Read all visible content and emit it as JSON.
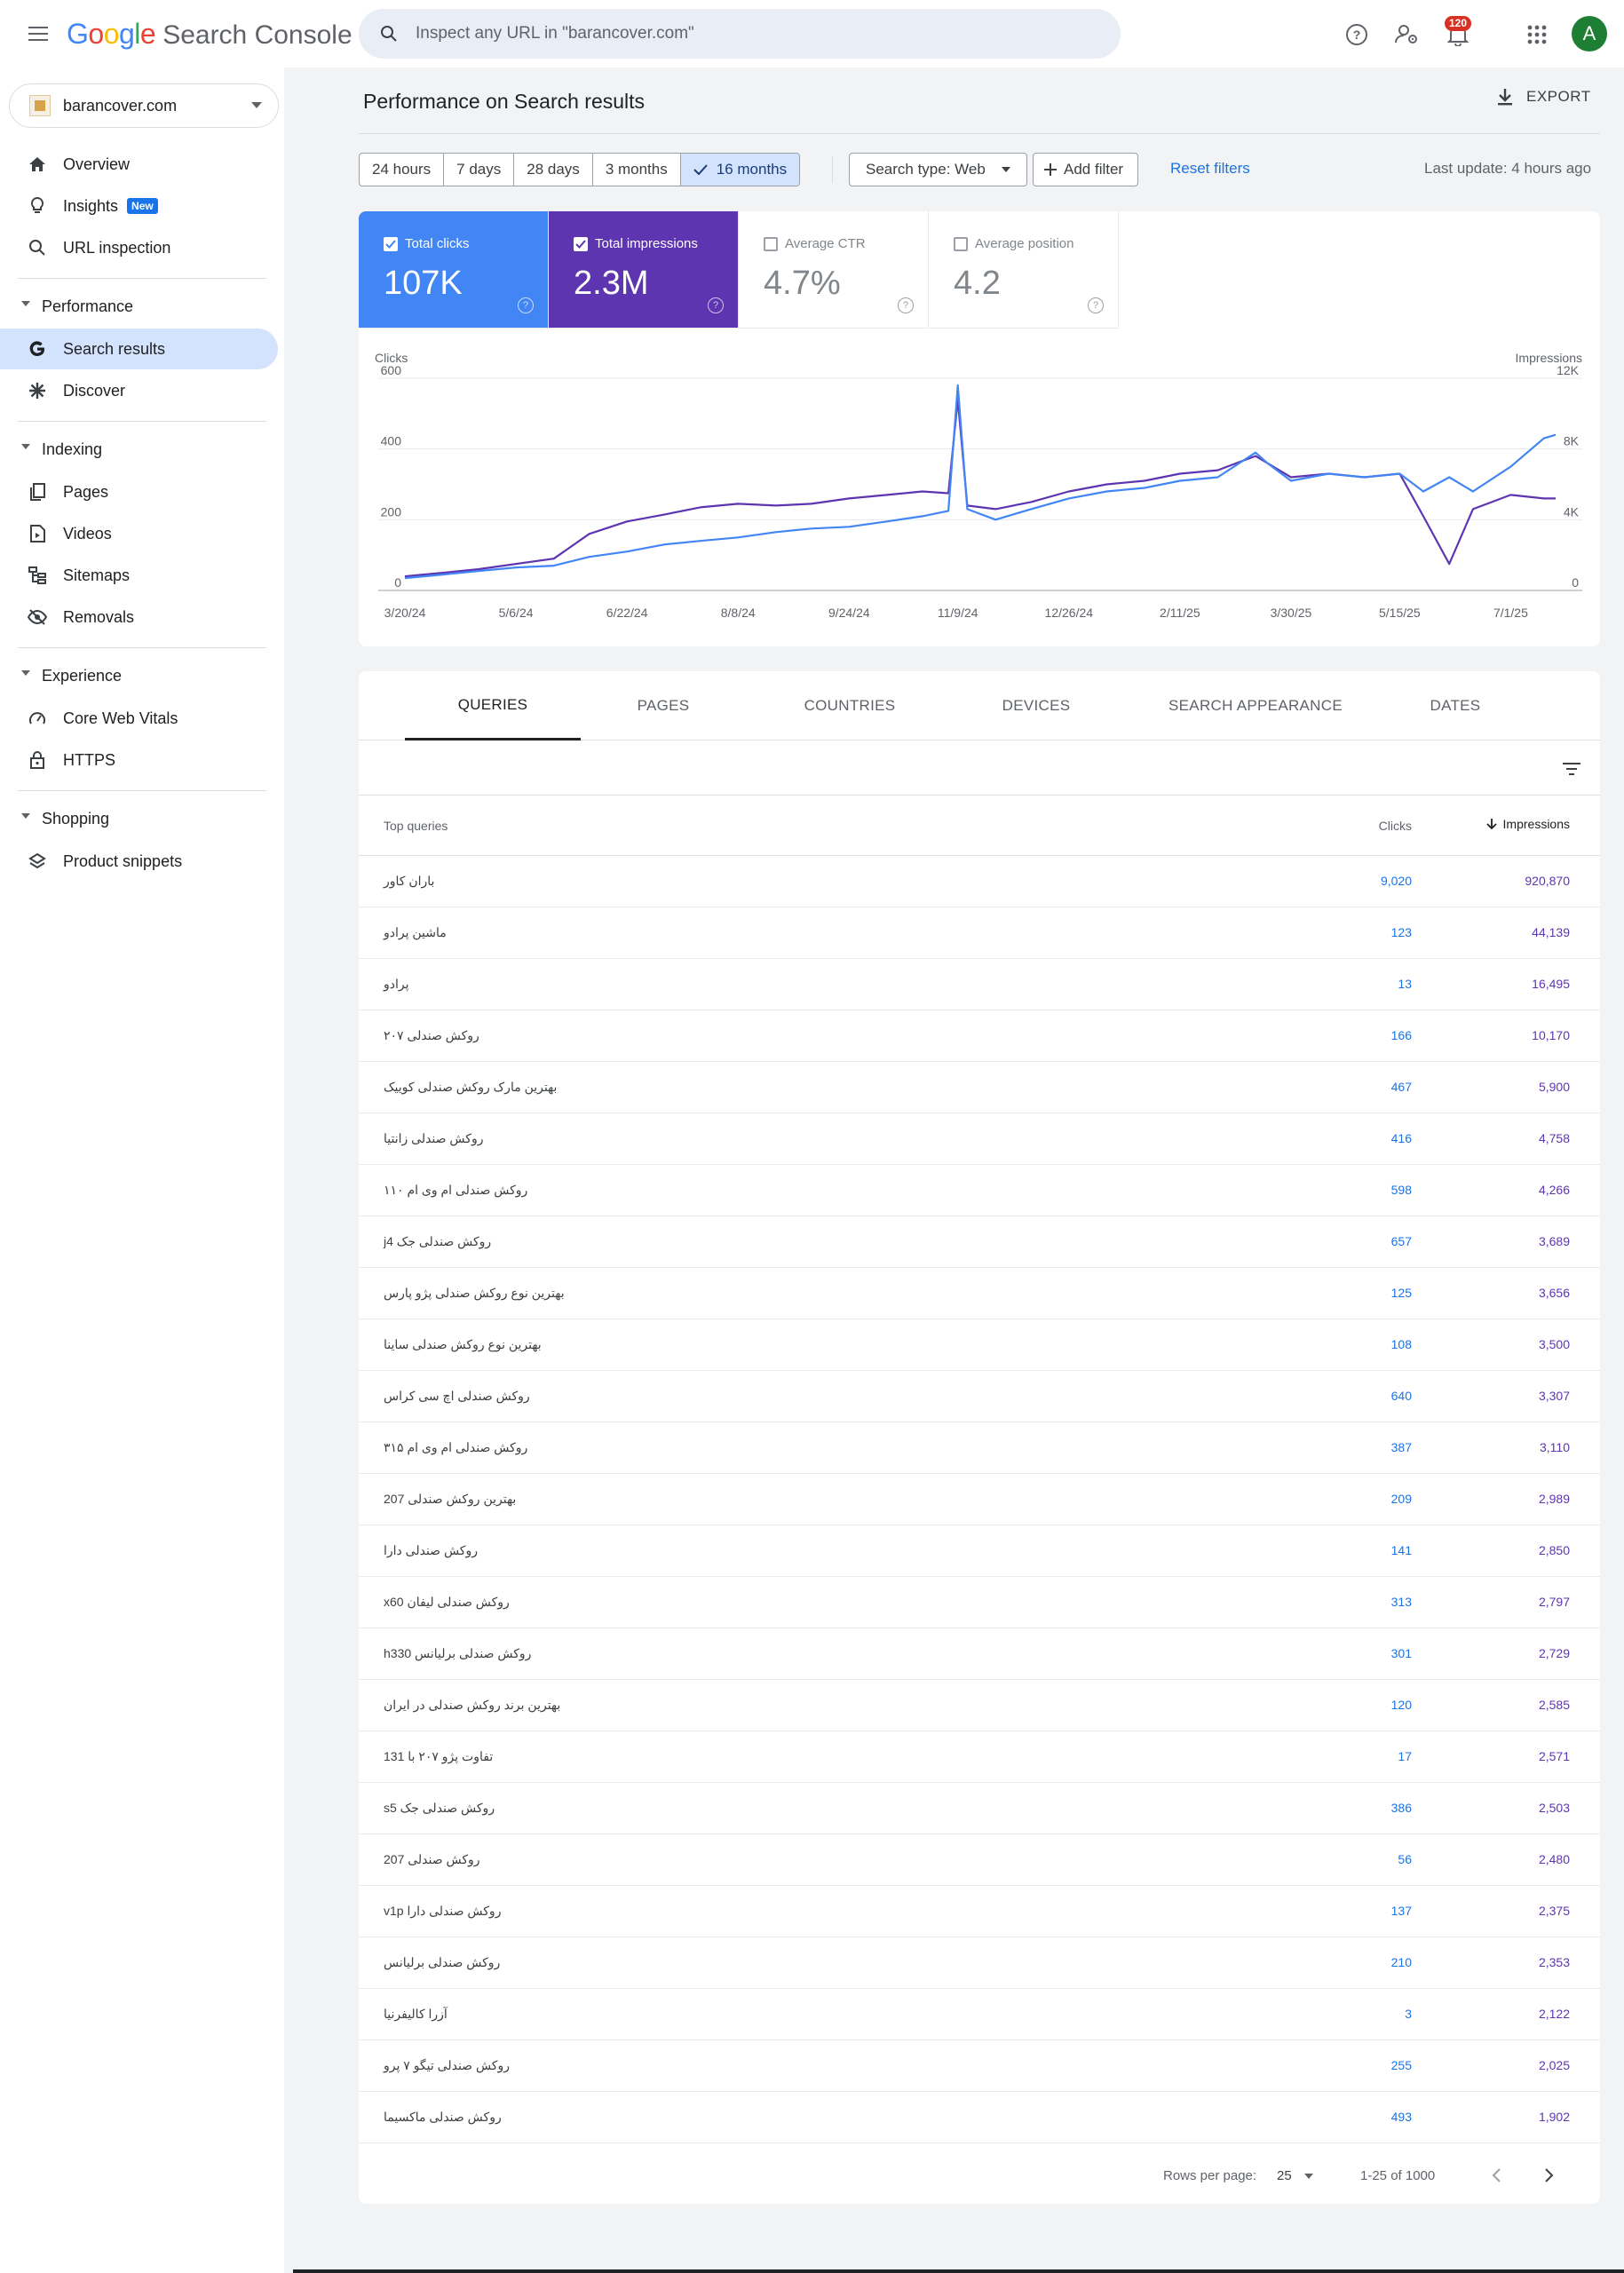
{
  "header": {
    "logo_google": [
      "G",
      "o",
      "o",
      "g",
      "l",
      "e"
    ],
    "logo_google_colors": [
      "#4285f4",
      "#ea4335",
      "#fbbc05",
      "#4285f4",
      "#34a853",
      "#ea4335"
    ],
    "logo_product": "Search Console",
    "search_placeholder": "Inspect any URL in \"barancover.com\"",
    "notification_count": "120",
    "avatar_letter": "A"
  },
  "sidebar": {
    "property": "barancover.com",
    "items_top": [
      {
        "label": "Overview",
        "icon": "home-icon"
      },
      {
        "label": "Insights",
        "icon": "lightbulb-icon",
        "badge": "New"
      },
      {
        "label": "URL inspection",
        "icon": "search-icon"
      }
    ],
    "sections": [
      {
        "title": "Performance",
        "items": [
          {
            "label": "Search results",
            "icon": "google-g-icon",
            "active": true
          },
          {
            "label": "Discover",
            "icon": "asterisk-icon"
          }
        ]
      },
      {
        "title": "Indexing",
        "items": [
          {
            "label": "Pages",
            "icon": "pages-icon"
          },
          {
            "label": "Videos",
            "icon": "video-file-icon"
          },
          {
            "label": "Sitemaps",
            "icon": "sitemap-icon"
          },
          {
            "label": "Removals",
            "icon": "eye-off-icon"
          }
        ]
      },
      {
        "title": "Experience",
        "items": [
          {
            "label": "Core Web Vitals",
            "icon": "gauge-icon"
          },
          {
            "label": "HTTPS",
            "icon": "lock-icon"
          }
        ]
      },
      {
        "title": "Shopping",
        "items": [
          {
            "label": "Product snippets",
            "icon": "layers-icon"
          }
        ]
      }
    ]
  },
  "main": {
    "title": "Performance on Search results",
    "export_label": "EXPORT",
    "date_ranges": [
      {
        "label": "24 hours",
        "active": false
      },
      {
        "label": "7 days",
        "active": false
      },
      {
        "label": "28 days",
        "active": false
      },
      {
        "label": "3 months",
        "active": false
      },
      {
        "label": "16 months",
        "active": true
      }
    ],
    "search_type": "Search type: Web",
    "add_filter": "Add filter",
    "reset_filters": "Reset filters",
    "last_update": "Last update: 4 hours ago",
    "metrics": [
      {
        "label": "Total clicks",
        "value": "107K",
        "checked": true,
        "color": "#4285f4"
      },
      {
        "label": "Total impressions",
        "value": "2.3M",
        "checked": true,
        "color": "#5e35b1"
      },
      {
        "label": "Average CTR",
        "value": "4.7%",
        "checked": false,
        "color": "#ffffff"
      },
      {
        "label": "Average position",
        "value": "4.2",
        "checked": false,
        "color": "#ffffff"
      }
    ],
    "tabs": [
      {
        "label": "QUERIES",
        "active": true
      },
      {
        "label": "PAGES",
        "active": false
      },
      {
        "label": "COUNTRIES",
        "active": false
      },
      {
        "label": "DEVICES",
        "active": false
      },
      {
        "label": "SEARCH APPEARANCE",
        "active": false
      },
      {
        "label": "DATES",
        "active": false
      }
    ],
    "table": {
      "col_query": "Top queries",
      "col_clicks": "Clicks",
      "col_impressions": "Impressions",
      "rows": [
        {
          "q": "باران کاور",
          "c": "9,020",
          "i": "920,870"
        },
        {
          "q": "ماشین پرادو",
          "c": "123",
          "i": "44,139"
        },
        {
          "q": "پرادو",
          "c": "13",
          "i": "16,495"
        },
        {
          "q": "روکش صندلی ۲۰۷",
          "c": "166",
          "i": "10,170"
        },
        {
          "q": "بهترین مارک روکش صندلی کوییک",
          "c": "467",
          "i": "5,900"
        },
        {
          "q": "روکش صندلی زانتیا",
          "c": "416",
          "i": "4,758"
        },
        {
          "q": "روکش صندلی ام وی ام ۱۱۰",
          "c": "598",
          "i": "4,266"
        },
        {
          "q": "روکش صندلی جک j4",
          "c": "657",
          "i": "3,689"
        },
        {
          "q": "بهترین نوع روکش صندلی پژو پارس",
          "c": "125",
          "i": "3,656"
        },
        {
          "q": "بهترین نوع روکش صندلی ساینا",
          "c": "108",
          "i": "3,500"
        },
        {
          "q": "روکش صندلی اچ سی کراس",
          "c": "640",
          "i": "3,307"
        },
        {
          "q": "روکش صندلی ام وی ام ۳۱۵",
          "c": "387",
          "i": "3,110"
        },
        {
          "q": "بهترین روکش صندلی 207",
          "c": "209",
          "i": "2,989"
        },
        {
          "q": "روکش صندلی دارا",
          "c": "141",
          "i": "2,850"
        },
        {
          "q": "روکش صندلی لیفان x60",
          "c": "313",
          "i": "2,797"
        },
        {
          "q": "روکش صندلی برلیانس h330",
          "c": "301",
          "i": "2,729"
        },
        {
          "q": "بهترین برند روکش صندلی در ایران",
          "c": "120",
          "i": "2,585"
        },
        {
          "q": "تفاوت پژو ۲۰۷ با 131",
          "c": "17",
          "i": "2,571"
        },
        {
          "q": "روکش صندلی جک s5",
          "c": "386",
          "i": "2,503"
        },
        {
          "q": "روکش صندلی 207",
          "c": "56",
          "i": "2,480"
        },
        {
          "q": "روکش صندلی دارا v1p",
          "c": "137",
          "i": "2,375"
        },
        {
          "q": "روکش صندلی برلیانس",
          "c": "210",
          "i": "2,353"
        },
        {
          "q": "آزرا کالیفرنیا",
          "c": "3",
          "i": "2,122"
        },
        {
          "q": "روکش صندلی تیگو ۷ پرو",
          "c": "255",
          "i": "2,025"
        },
        {
          "q": "روکش صندلی ماکسیما",
          "c": "493",
          "i": "1,902"
        }
      ]
    },
    "pagination": {
      "rows_per_page_label": "Rows per page:",
      "rows_per_page": "25",
      "range": "1-25 of 1000"
    }
  },
  "chart_data": {
    "type": "line",
    "xlabel": "",
    "ylabel": "Clicks",
    "ylabel_right": "Impressions",
    "ylim": [
      0,
      600
    ],
    "ylim_right": [
      0,
      12000
    ],
    "y_ticks": [
      "0",
      "200",
      "400",
      "600"
    ],
    "y_ticks_right": [
      "0",
      "4K",
      "8K",
      "12K"
    ],
    "x_ticks": [
      "3/20/24",
      "5/6/24",
      "6/22/24",
      "8/8/24",
      "9/24/24",
      "11/9/24",
      "12/26/24",
      "2/11/25",
      "3/30/25",
      "5/15/25",
      "7/1/25"
    ],
    "grid": true,
    "series": [
      {
        "name": "Clicks",
        "axis": "left",
        "color": "#4285f4",
        "x": [
          "3/20/24",
          "4/5/24",
          "4/20/24",
          "5/6/24",
          "5/22/24",
          "6/6/24",
          "6/22/24",
          "7/8/24",
          "7/23/24",
          "8/8/24",
          "8/24/24",
          "9/8/24",
          "9/24/24",
          "10/10/24",
          "10/25/24",
          "11/5/24",
          "11/9/24",
          "11/13/24",
          "11/25/24",
          "12/10/24",
          "12/26/24",
          "1/11/25",
          "1/27/25",
          "2/11/25",
          "2/27/25",
          "3/15/25",
          "3/20/25",
          "3/30/25",
          "4/15/25",
          "4/30/25",
          "5/15/25",
          "5/25/25",
          "6/5/25",
          "6/15/25",
          "7/1/25",
          "7/15/25",
          "7/20/25"
        ],
        "values": [
          35,
          45,
          55,
          65,
          70,
          95,
          110,
          130,
          140,
          150,
          165,
          175,
          180,
          195,
          210,
          225,
          580,
          230,
          200,
          230,
          260,
          280,
          290,
          310,
          320,
          390,
          360,
          310,
          330,
          320,
          330,
          280,
          320,
          280,
          350,
          430,
          440
        ]
      },
      {
        "name": "Impressions",
        "axis": "right",
        "color": "#5e35b1",
        "x": [
          "3/20/24",
          "4/5/24",
          "4/20/24",
          "5/6/24",
          "5/22/24",
          "6/6/24",
          "6/22/24",
          "7/8/24",
          "7/23/24",
          "8/8/24",
          "8/24/24",
          "9/8/24",
          "9/24/24",
          "10/10/24",
          "10/25/24",
          "11/5/24",
          "11/9/24",
          "11/13/24",
          "11/25/24",
          "12/10/24",
          "12/26/24",
          "1/11/25",
          "1/27/25",
          "2/11/25",
          "2/27/25",
          "3/15/25",
          "3/20/25",
          "3/30/25",
          "4/15/25",
          "4/30/25",
          "5/15/25",
          "5/25/25",
          "6/5/25",
          "6/15/25",
          "7/1/25",
          "7/15/25",
          "7/20/25"
        ],
        "values": [
          800,
          1000,
          1200,
          1500,
          1800,
          3200,
          3900,
          4300,
          4700,
          4900,
          4800,
          4900,
          5200,
          5400,
          5600,
          5500,
          10800,
          4800,
          4600,
          5000,
          5600,
          6000,
          6200,
          6600,
          6800,
          7600,
          7200,
          6400,
          6600,
          6400,
          6600,
          4200,
          1500,
          4600,
          5400,
          5200,
          5200
        ]
      }
    ]
  }
}
